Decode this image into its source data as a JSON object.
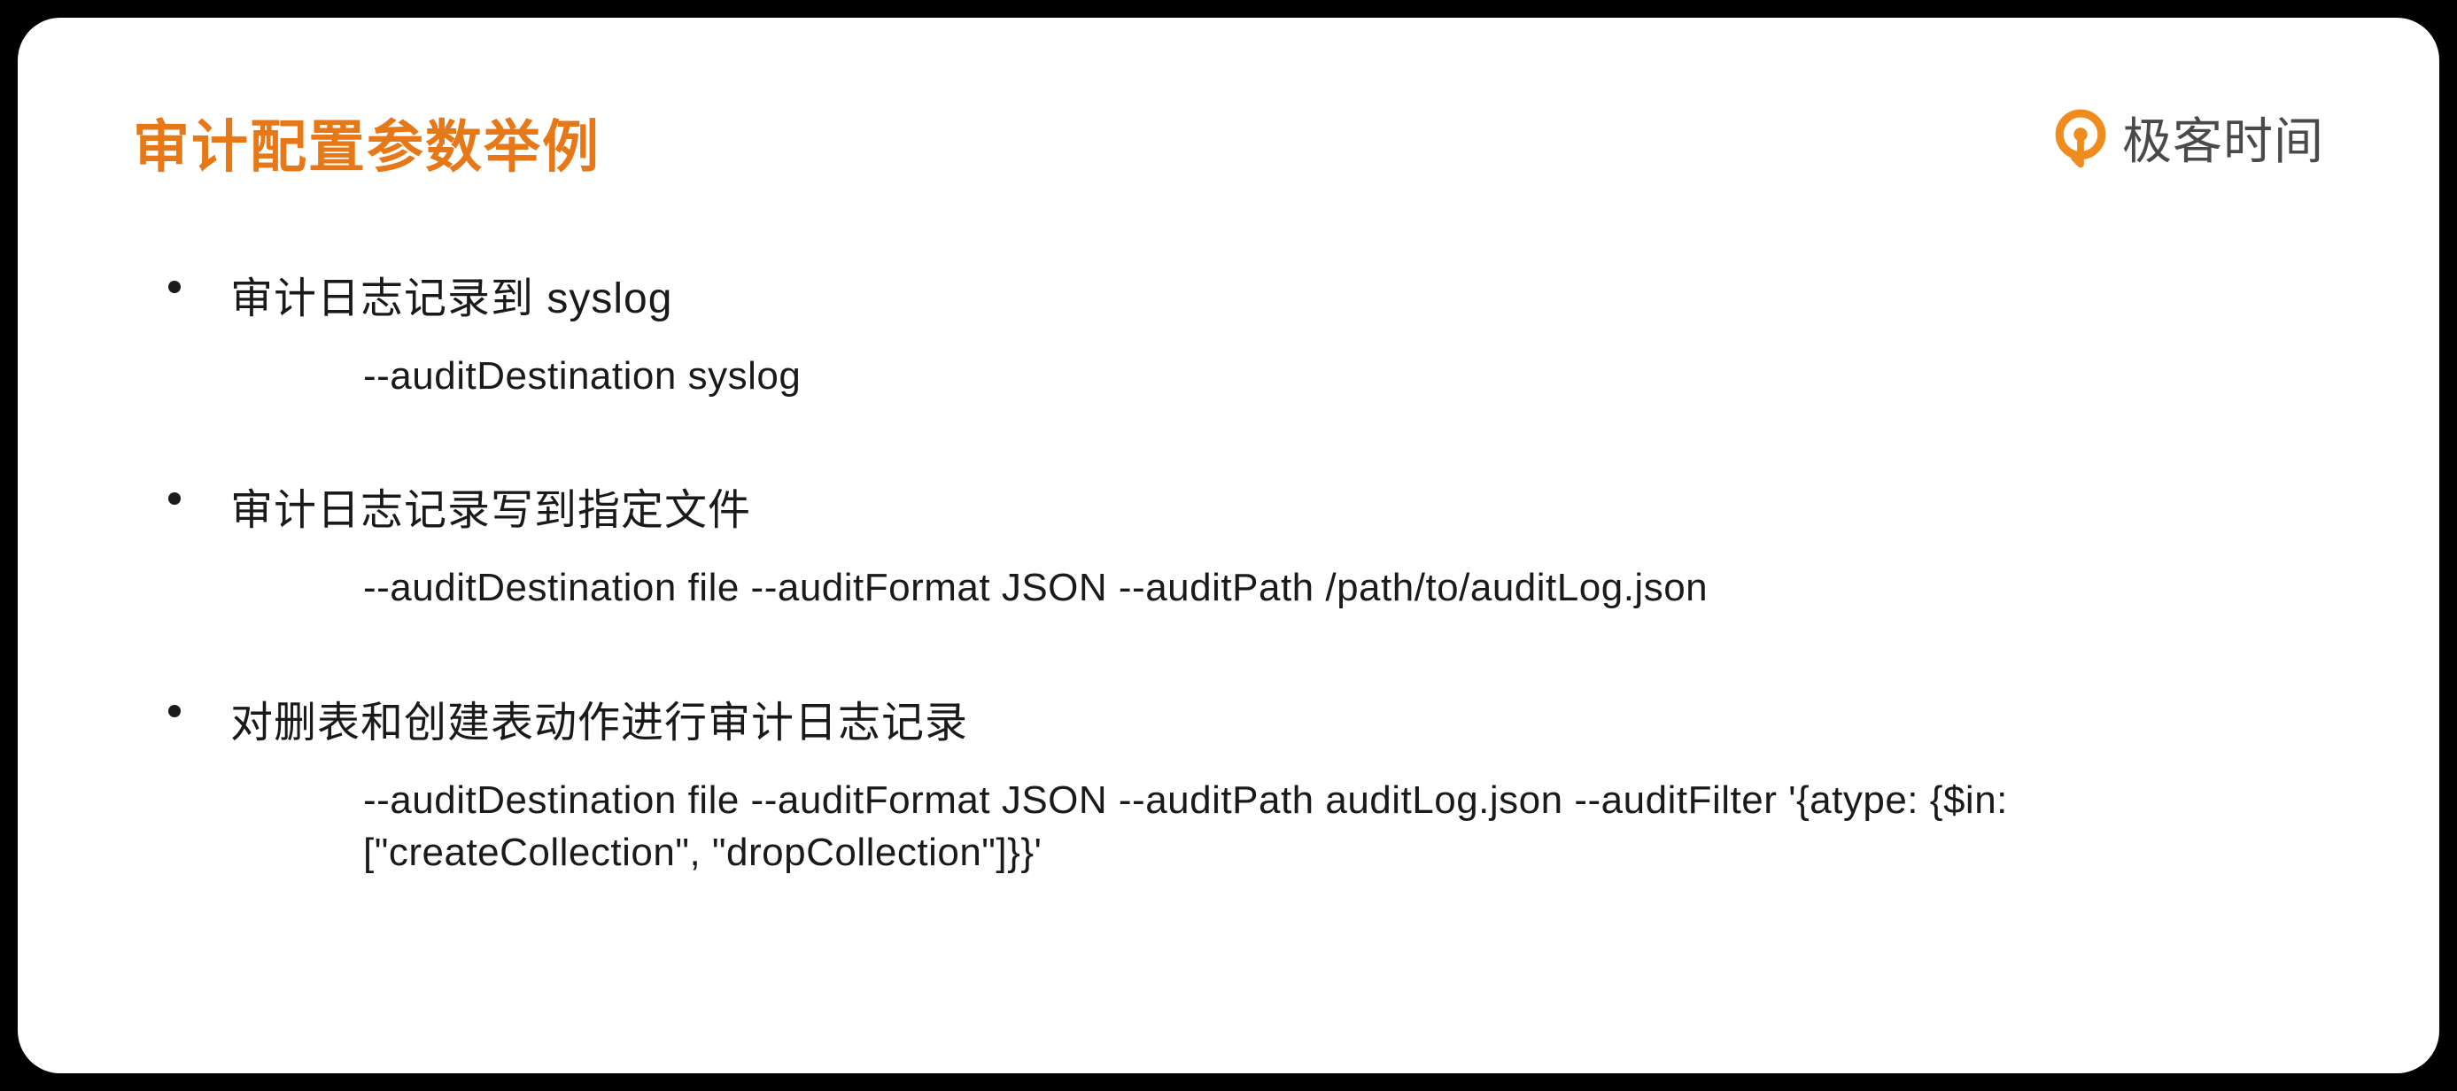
{
  "title": "审计配置参数举例",
  "logo": {
    "text": "极客时间"
  },
  "items": [
    {
      "title": "审计日志记录到 syslog",
      "command": "--auditDestination  syslog"
    },
    {
      "title": "审计日志记录写到指定文件",
      "command": "--auditDestination  file  --auditFormat  JSON  --auditPath  /path/to/auditLog.json"
    },
    {
      "title": "对删表和创建表动作进行审计日志记录",
      "command": "--auditDestination file --auditFormat JSON --auditPath auditLog.json --auditFilter '{atype: {$in: [\"createCollection\", \"dropCollection\"]}}'"
    }
  ]
}
